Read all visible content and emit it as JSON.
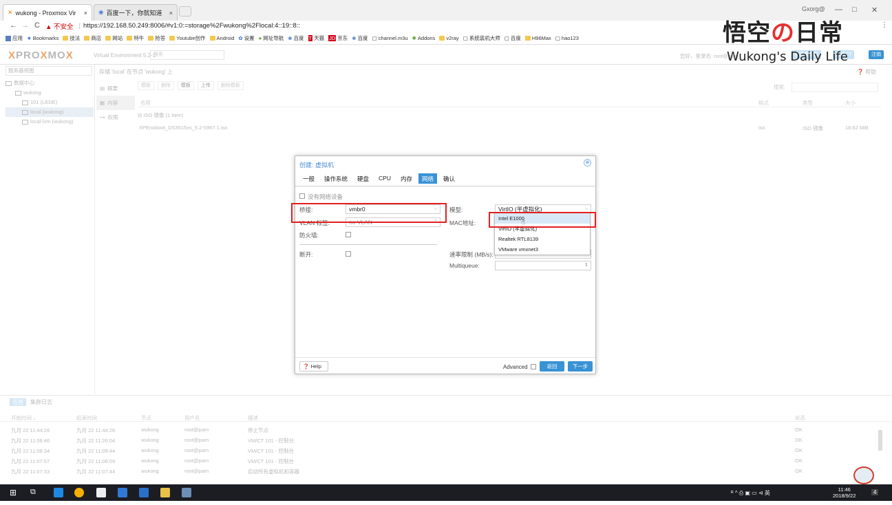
{
  "browser": {
    "tabs": [
      {
        "label": "wukong - Proxmox Vir",
        "close": "×"
      },
      {
        "label": "百度一下，你就知道",
        "close": "×"
      }
    ],
    "window_user": "Gxorg@",
    "win_min": "—",
    "win_max": "□",
    "win_close": "✕",
    "back": "←",
    "forward": "→",
    "reload": "C",
    "insecure_label": "▲ 不安全",
    "url": "https://192.168.50.249:8006/#v1:0:=storage%2Fwukong%2Flocal:4::19::8::",
    "menu_dots": "⋮"
  },
  "bookmarks": {
    "apps": "应用",
    "items": [
      "Bookmarks",
      "技法",
      "商店",
      "网站",
      "特牛",
      "抢答",
      "Youtube创作",
      "Android",
      "设置",
      "网址导航",
      "百度",
      "天猫",
      "京东",
      "百度",
      "channel.m3u",
      "Addons",
      "v2ray",
      "系统装机大师",
      "百度",
      "H96Max",
      "hao123"
    ],
    "more": "»"
  },
  "watermark": {
    "line1_a": "悟空",
    "line1_o": "の",
    "line1_b": "日常",
    "line2": "Wukong's Daily Life"
  },
  "pve": {
    "logo_a": "PRO",
    "logo_b": "X",
    "logo_c": "MO",
    "logo_d": "X",
    "version": "Virtual Environment 5.2-1",
    "search_placeholder": "搜索",
    "user_info": "您好，登录名: root@pam",
    "header_buttons": [
      "创建虚拟机",
      "创建CT",
      "注销"
    ],
    "view_selector": "服务器视图",
    "tree": [
      "数据中心",
      "wukong",
      "101 (LEDE)",
      "local (wukong)",
      "local-lvm (wukong)"
    ],
    "breadcrumb": "存储 'local' 在节点 'wukong' 上",
    "help": "帮助",
    "subnav": [
      "概要",
      "内容",
      "权限"
    ],
    "toolbar": [
      "模板",
      "删除",
      "模板",
      "上传",
      "删除模板"
    ],
    "search_label": "搜索:",
    "columns": [
      "名称",
      "格式",
      "类型",
      "大小"
    ],
    "group_header": "⊟ ISO 镜像 (1 Item)",
    "rows": [
      {
        "name": "XPEnoboot_DS3615xs_5.2-5967.1.iso",
        "format": "iso",
        "type": "ISO 镜像",
        "size": "18.62 MiB"
      }
    ]
  },
  "tasks": {
    "tabs": [
      "任务",
      "集群日志"
    ],
    "columns": [
      "开始时间 ↓",
      "结束时间",
      "节点",
      "用户名",
      "描述",
      "状态"
    ],
    "rows": [
      {
        "start": "九月 22 11:44:26",
        "end": "九月 22 11:44:26",
        "node": "wukong",
        "user": "root@pam",
        "desc": "停止节点",
        "status": "OK"
      },
      {
        "start": "九月 22 11:06:46",
        "end": "九月 22 11:26:04",
        "node": "wukong",
        "user": "root@pam",
        "desc": "VM/CT 101 - 控制台",
        "status": "OK"
      },
      {
        "start": "九月 22 11:08:34",
        "end": "九月 22 11:09:44",
        "node": "wukong",
        "user": "root@pam",
        "desc": "VM/CT 101 - 控制台",
        "status": "OK"
      },
      {
        "start": "九月 22 11:07:57",
        "end": "九月 22 11:08:09",
        "node": "wukong",
        "user": "root@pam",
        "desc": "VM/CT 101 - 控制台",
        "status": "OK"
      },
      {
        "start": "九月 22 11:07:33",
        "end": "九月 22 11:07:44",
        "node": "wukong",
        "user": "root@pam",
        "desc": "启动所有虚拟机和容器",
        "status": "OK"
      }
    ]
  },
  "dialog": {
    "title": "创建: 虚拟机",
    "close": "⊗",
    "tabs": [
      "一般",
      "操作系统",
      "硬盘",
      "CPU",
      "内存",
      "网络",
      "确认"
    ],
    "active_tab": "网络",
    "no_network": "没有网络设备",
    "bridge_label": "桥接:",
    "bridge_value": "vmbr0",
    "vlan_label": "VLAN 标签:",
    "vlan_value": "no VLAN",
    "firewall_label": "防火墙:",
    "disconnect_label": "断开:",
    "model_label": "模型:",
    "model_value": "VirtIO (半虚拟化)",
    "mac_label": "MAC地址:",
    "rate_label": "速率限制 (MB/s):",
    "multiqueue_label": "Multiqueue:",
    "help_button": "Help",
    "advanced_label": "Advanced",
    "back_button": "返回",
    "next_button": "下一步",
    "model_options": [
      "Intel E1000",
      "VirtIO (半虚拟化)",
      "Realtek RTL8139",
      "VMware vmxnet3"
    ],
    "highlighted_option": "Intel E1000"
  },
  "taskbar": {
    "tray_text": "ᴿ ^ ⎙ ▣ ▭ ⊲ 英",
    "time": "11:46",
    "date": "2018/9/22",
    "notif": "4"
  },
  "colors": {
    "accent": "#3892d4",
    "highlight": "#e51d1d",
    "taskbar": "#1b1d22"
  }
}
